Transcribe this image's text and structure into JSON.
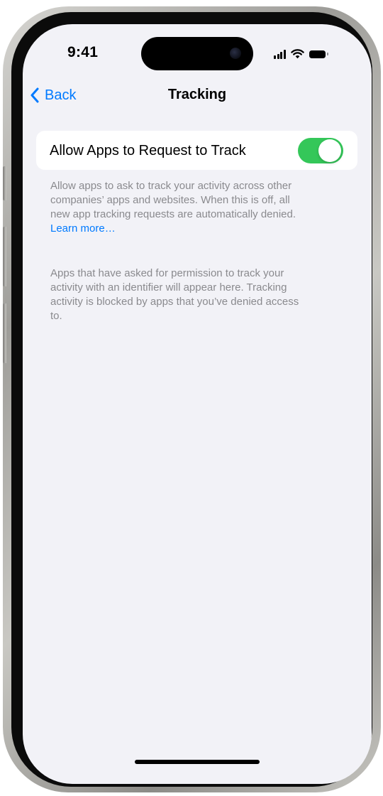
{
  "status_bar": {
    "time": "9:41",
    "icons": [
      "cellular-signal-icon",
      "wifi-icon",
      "battery-icon"
    ]
  },
  "nav": {
    "back_label": "Back",
    "title": "Tracking"
  },
  "toggle_cell": {
    "label": "Allow Apps to Request to Track",
    "enabled": true
  },
  "footer_1": {
    "line_1": "Allow apps to ask to track your activity across other",
    "line_2": "companies’ apps and websites. When this is off, all",
    "line_3": "new app tracking requests are automatically denied.",
    "link": "Learn more…"
  },
  "footer_2": {
    "line_1": "Apps that have asked for permission to track your",
    "line_2": "activity with an identifier will appear here. Tracking",
    "line_3": "activity is blocked by apps that you’ve denied access",
    "line_4": "to."
  },
  "colors": {
    "accent": "#007aff",
    "switch_on": "#34c759",
    "background": "#f2f2f7",
    "footer_text": "#8a8a8e"
  }
}
